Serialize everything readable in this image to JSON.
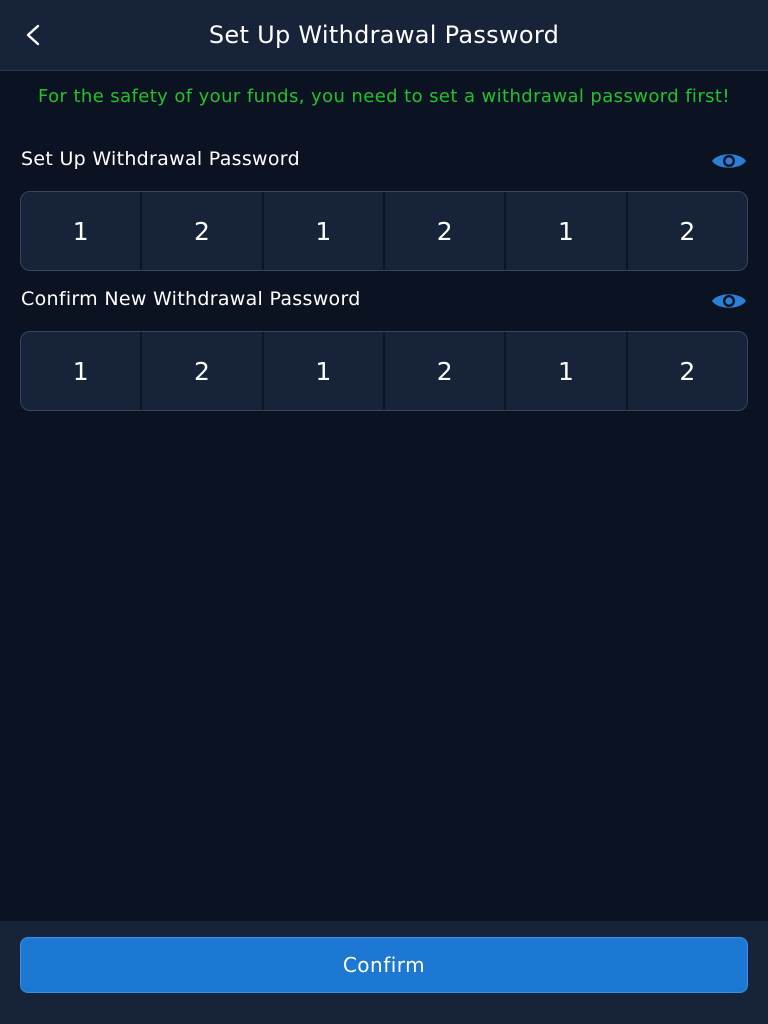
{
  "header": {
    "title": "Set Up Withdrawal Password",
    "back_icon": "chevron-left-icon"
  },
  "notice": "For the safety of your funds, you need to set a withdrawal password first!",
  "password_field": {
    "label": "Set Up Withdrawal Password",
    "visibility_icon": "eye-icon",
    "digits": [
      "1",
      "2",
      "1",
      "2",
      "1",
      "2"
    ]
  },
  "confirm_field": {
    "label": "Confirm New Withdrawal Password",
    "visibility_icon": "eye-icon",
    "digits": [
      "1",
      "2",
      "1",
      "2",
      "1",
      "2"
    ]
  },
  "footer": {
    "confirm_label": "Confirm"
  },
  "colors": {
    "background": "#0b1322",
    "panel": "#162338",
    "notice_green": "#22c22f",
    "accent_blue": "#1c78d3",
    "eye_blue": "#2a7fd6"
  }
}
